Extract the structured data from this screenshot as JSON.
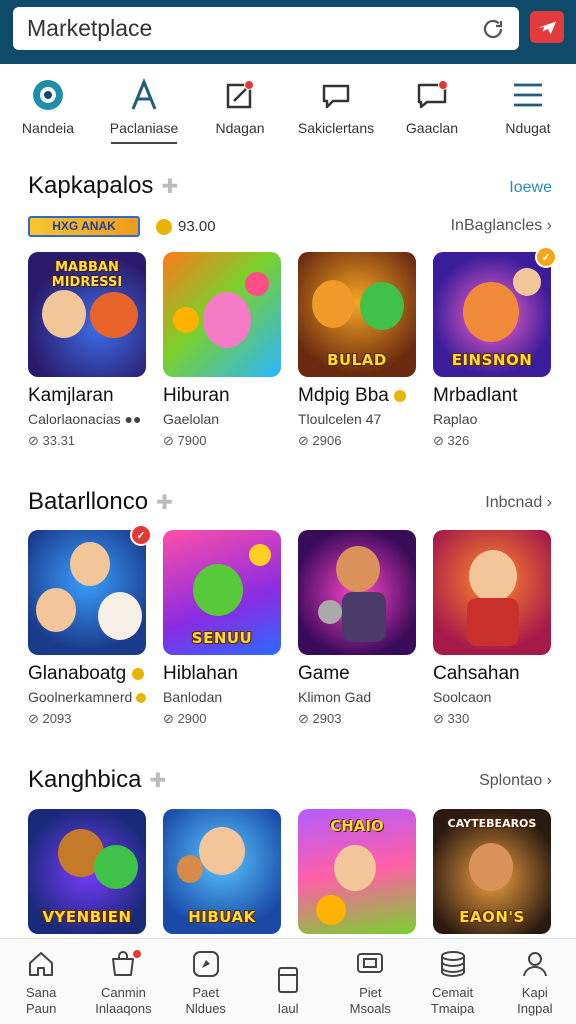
{
  "search": {
    "text": "Marketplace"
  },
  "nav": [
    {
      "label": "Nandeia",
      "icon": "target-icon",
      "active": false
    },
    {
      "label": "Paclaniase",
      "icon": "letter-a-icon",
      "active": true
    },
    {
      "label": "Ndagan",
      "icon": "edit-icon",
      "active": false
    },
    {
      "label": "Sakiclertans",
      "icon": "chat-bubble-icon",
      "active": false
    },
    {
      "label": "Gaaclan",
      "icon": "message-icon",
      "active": false
    },
    {
      "label": "Ndugat",
      "icon": "menu-icon",
      "active": false
    }
  ],
  "sections": [
    {
      "title": "Kapkapalos",
      "link": "Ioewe",
      "promo": {
        "banner": "HXG ANAK",
        "rating": "93.00",
        "link": "InBaglancles ›"
      },
      "cards": [
        {
          "caption": "MABBAN MIDRESSI",
          "name": "Kamjlaran",
          "sub": "Calorlaonacias ●●",
          "price": "⊘ 33.31"
        },
        {
          "caption": "",
          "name": "Hiburan",
          "sub": "Gaelolan",
          "price": "⊘ 7900"
        },
        {
          "caption": "BULAD",
          "name": "Mdpig Bba",
          "sub": "Tloulcelen 47",
          "price": "⊘ 2906"
        },
        {
          "caption": "EINSNON",
          "name": "Mrbadlant",
          "sub": "Raplao",
          "price": "⊘ 326"
        }
      ]
    },
    {
      "title": "Batarllonco",
      "link": "Inbcnad ›",
      "cards": [
        {
          "caption": "",
          "name": "Glanaboatg",
          "sub": "Goolnerkamnerd",
          "price": "⊘ 2093"
        },
        {
          "caption": "SENUU",
          "name": "Hiblahan",
          "sub": "Banlodan",
          "price": "⊘ 2900"
        },
        {
          "caption": "",
          "name": "Game",
          "sub": "Klimon Gad",
          "price": "⊘ 2903"
        },
        {
          "caption": "",
          "name": "Cahsahan",
          "sub": "Soolcaon",
          "price": "⊘ 330"
        }
      ]
    },
    {
      "title": "Kanghbica",
      "link": "Splontao ›",
      "cards": [
        {
          "caption": "VYENBIEN",
          "name": "",
          "sub": "",
          "price": ""
        },
        {
          "caption": "HIBUAK",
          "name": "",
          "sub": "",
          "price": ""
        },
        {
          "caption": "",
          "name": "",
          "sub": "",
          "price": ""
        },
        {
          "caption": "EAON'S",
          "topcap": "CAYTEBEAROS",
          "name": "",
          "sub": "",
          "price": ""
        }
      ]
    }
  ],
  "bottom_nav": [
    {
      "label": "Sana\nPaun",
      "icon": "home-icon"
    },
    {
      "label": "Canmin\nInlaaqons",
      "icon": "store-icon"
    },
    {
      "label": "Paet\nNldues",
      "icon": "compass-icon"
    },
    {
      "label": "Iaul",
      "icon": "tablet-icon"
    },
    {
      "label": "Piet\nMsoals",
      "icon": "media-icon"
    },
    {
      "label": "Cemait\nTmaipa",
      "icon": "database-icon"
    },
    {
      "label": "Kapi\nIngpal",
      "icon": "user-icon"
    }
  ],
  "colors": {
    "topbar": "#0f4a6b",
    "accent": "#2a8cb8",
    "badge": "#e53935"
  }
}
